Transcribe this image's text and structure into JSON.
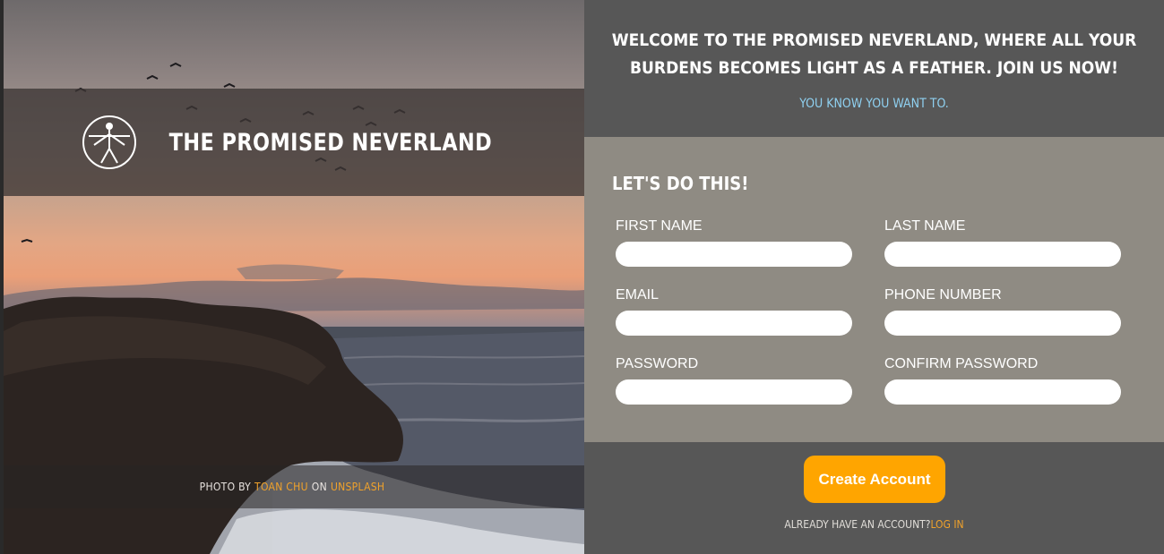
{
  "hero": {
    "brand_title": "THE PROMISED NEVERLAND",
    "credit": {
      "prefix": "PHOTO BY",
      "photographer": "TOAN CHU",
      "middle": "ON",
      "source": "UNSPLASH"
    }
  },
  "panel": {
    "welcome": "WELCOME TO THE PROMISED NEVERLAND, WHERE ALL YOUR BURDENS BECOMES LIGHT AS A FEATHER. JOIN US NOW!",
    "tagline": "YOU KNOW YOU WANT TO.",
    "form": {
      "heading": "LET'S DO THIS!",
      "fields": [
        {
          "label": "FIRST NAME",
          "value": ""
        },
        {
          "label": "LAST NAME",
          "value": ""
        },
        {
          "label": "EMAIL",
          "value": ""
        },
        {
          "label": "PHONE NUMBER",
          "value": ""
        },
        {
          "label": "PASSWORD",
          "value": ""
        },
        {
          "label": "CONFIRM PASSWORD",
          "value": ""
        }
      ]
    },
    "create_button": "Create Account",
    "login_prompt": "ALREADY HAVE AN ACCOUNT?",
    "login_link": "LOG IN"
  },
  "colors": {
    "accent": "#ffa500",
    "link": "#f0a22b",
    "tagline": "#8fd0f0",
    "panel_dark": "#575757",
    "form_bg": "#8f8b83"
  }
}
